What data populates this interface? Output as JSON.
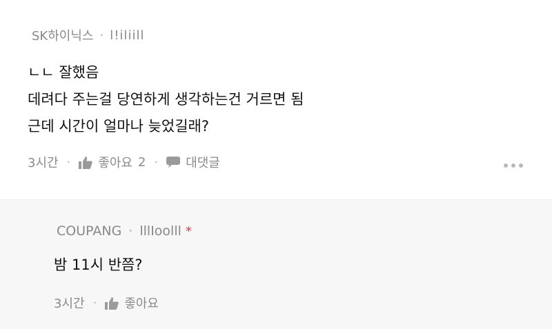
{
  "comment": {
    "company": "SK하이닉스",
    "nickname": "l!iliill",
    "lines": [
      "ㄴㄴ 잘했음",
      "데려다 주는걸 당연하게 생각하는건 거르면 됨",
      "근데 시간이 얼마나 늦었길래?"
    ],
    "time": "3시간",
    "like_label": "좋아요",
    "like_count": "2",
    "reply_label": "대댓글"
  },
  "reply": {
    "company": "COUPANG",
    "nickname": "lllIoolll",
    "author_mark": "*",
    "text": "밤 11시 반쯤?",
    "time": "3시간",
    "like_label": "좋아요"
  },
  "colors": {
    "accent_star": "#e0334a",
    "meta_text": "#888888",
    "reply_background": "#f7f7f7"
  },
  "icons": [
    "thumbs-up-icon",
    "speech-bubble-icon",
    "more-icon"
  ]
}
